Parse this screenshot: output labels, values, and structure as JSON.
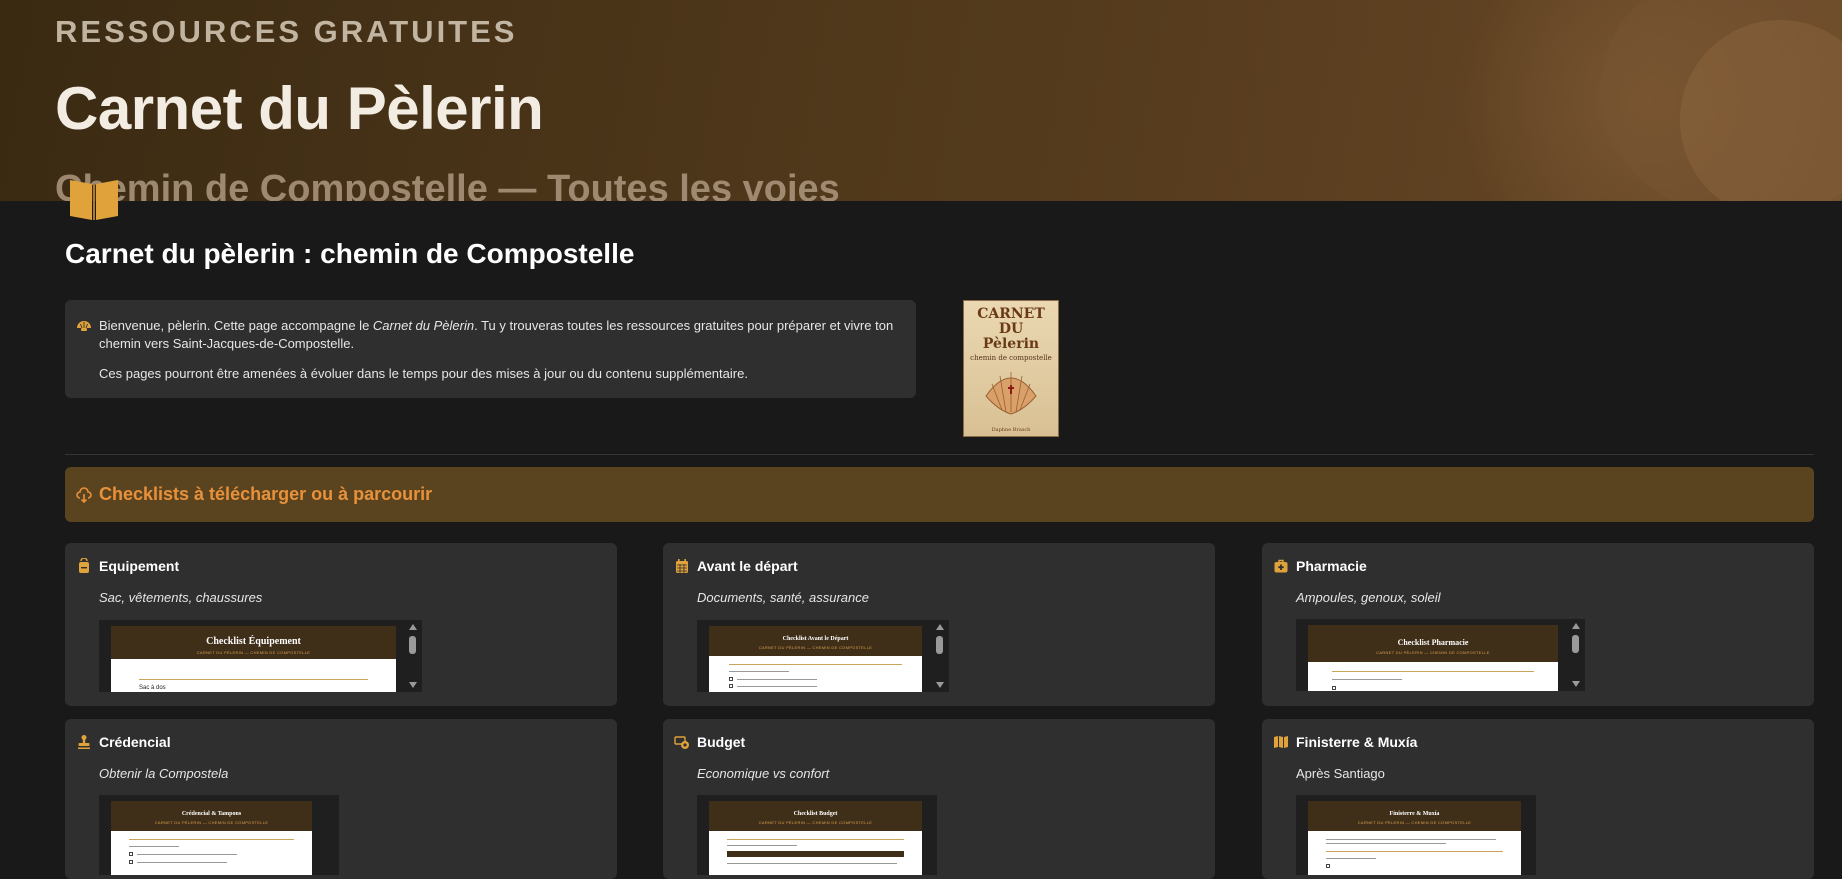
{
  "hero": {
    "eyebrow": "RESSOURCES GRATUITES",
    "title": "Carnet du Pèlerin",
    "subtitle": "Chemin de Compostelle — Toutes les voies"
  },
  "page": {
    "icon": "open-book-icon",
    "title": "Carnet du pèlerin : chemin de Compostelle"
  },
  "callout": {
    "icon": "shell-icon",
    "p1_before": "Bienvenue, pèlerin. Cette page accompagne le ",
    "p1_italic": "Carnet du Pèlerin",
    "p1_after": ". Tu y trouveras toutes les ressources gratuites pour préparer et vivre ton chemin vers Saint-Jacques-de-Compostelle.",
    "p2": "Ces pages pourront être amenées à évoluer dans le temps pour des mises à jour ou du contenu supplémentaire."
  },
  "cover": {
    "title_line1": "CARNET DU",
    "title_line2": "Pèlerin",
    "subtitle": "chemin de compostelle",
    "author": "Daphne Brasch"
  },
  "section": {
    "icon": "cloud-download-icon",
    "title": "Checklists à télécharger ou à parcourir"
  },
  "cards": [
    {
      "icon": "backpack-icon",
      "title": "Equipement",
      "subtitle": "Sac, vêtements, chaussures",
      "doc_title": "Checklist Équipement",
      "doc_sub": "CARNET DU PÈLERIN — CHEMIN DE COMPOSTELLE",
      "doc_line": "Sac à dos"
    },
    {
      "icon": "calendar-icon",
      "title": "Avant le départ",
      "subtitle": "Documents, santé, assurance",
      "doc_title": "Checklist Avant le Départ",
      "doc_sub": "CARNET DU PÈLERIN — CHEMIN DE COMPOSTELLE",
      "doc_line": ""
    },
    {
      "icon": "first-aid-kit-icon",
      "title": "Pharmacie",
      "subtitle": "Ampoules, genoux, soleil",
      "doc_title": "Checklist Pharmacie",
      "doc_sub": "CARNET DU PÈLERIN — CHEMIN DE COMPOSTELLE",
      "doc_line": ""
    },
    {
      "icon": "stamp-icon",
      "title": "Crédencial",
      "subtitle": "Obtenir la Compostela",
      "doc_title": "Crédencial & Tampons",
      "doc_sub": "CARNET DU PÈLERIN — CHEMIN DE COMPOSTELLE",
      "doc_line": ""
    },
    {
      "icon": "coins-icon",
      "title": "Budget",
      "subtitle": "Economique vs confort",
      "doc_title": "Checklist Budget",
      "doc_sub": "CARNET DU PÈLERIN — CHEMIN DE COMPOSTELLE",
      "doc_line": ""
    },
    {
      "icon": "map-icon",
      "title": "Finisterre & Muxía",
      "subtitle": "Après Santiago",
      "doc_title": "Finisterre & Muxía",
      "doc_sub": "CARNET DU PÈLERIN — CHEMIN DE COMPOSTELLE",
      "doc_line": ""
    }
  ],
  "colors": {
    "accent": "#e8913a",
    "icon_gold": "#e0a23a",
    "section_bg": "#5a4420",
    "card_bg": "#2f2f2f",
    "page_bg": "#191919"
  }
}
